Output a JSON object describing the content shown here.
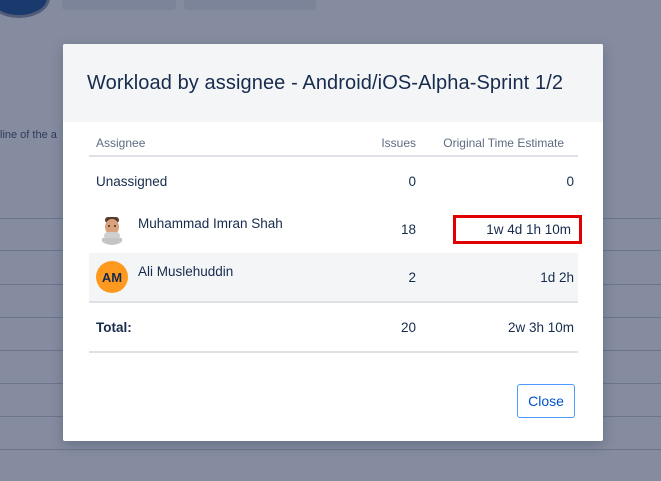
{
  "background": {
    "partial_text": "line of the a"
  },
  "modal": {
    "title": "Workload by assignee - Android/iOS-Alpha-Sprint 1/2",
    "columns": {
      "assignee": "Assignee",
      "issues": "Issues",
      "time": "Original Time Estimate"
    },
    "rows": [
      {
        "name": "Unassigned",
        "issues": "0",
        "time": "0",
        "avatar": "none"
      },
      {
        "name": "Muhammad Imran Shah",
        "issues": "18",
        "time": "1w 4d 1h 10m",
        "avatar": "memoji-avatar",
        "highlighted": true
      },
      {
        "name": "Ali Muslehuddin",
        "issues": "2",
        "time": "1d 2h",
        "avatar_initials": "AM"
      }
    ],
    "total": {
      "label": "Total:",
      "issues": "20",
      "time": "2w 3h 10m"
    },
    "close_label": "Close"
  },
  "colors": {
    "overlay": "#172347",
    "highlight": "#e00000",
    "avatar_am": "#ff991f",
    "link_blue": "#0052cc"
  }
}
